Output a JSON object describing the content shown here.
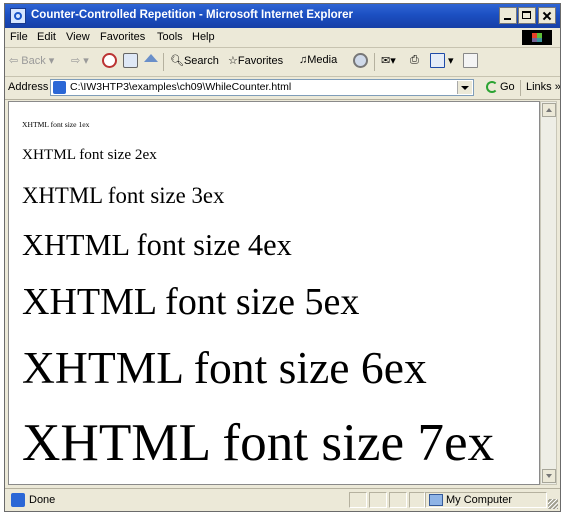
{
  "window": {
    "title": "Counter-Controlled Repetition - Microsoft Internet Explorer"
  },
  "menubar": {
    "items": [
      "File",
      "Edit",
      "View",
      "Favorites",
      "Tools",
      "Help"
    ]
  },
  "toolbar": {
    "back_label": "Back",
    "search_label": "Search",
    "favorites_label": "Favorites",
    "media_label": "Media"
  },
  "addressbar": {
    "label": "Address",
    "url": "C:\\IW3HTP3\\examples\\ch09\\WhileCounter.html",
    "go_label": "Go",
    "links_label": "Links »"
  },
  "content": {
    "lines": [
      {
        "text": "XHTML font size 1ex",
        "size_ex": 1
      },
      {
        "text": "XHTML font size 2ex",
        "size_ex": 2
      },
      {
        "text": "XHTML font size 3ex",
        "size_ex": 3
      },
      {
        "text": "XHTML font size 4ex",
        "size_ex": 4
      },
      {
        "text": "XHTML font size 5ex",
        "size_ex": 5
      },
      {
        "text": "XHTML font size 6ex",
        "size_ex": 6
      },
      {
        "text": "XHTML font size 7ex",
        "size_ex": 7
      }
    ]
  },
  "statusbar": {
    "status": "Done",
    "zone": "My Computer"
  },
  "colors": {
    "titlebar": "#1c4fc2",
    "chrome": "#ece9d8",
    "content_bg": "#ffffff"
  }
}
